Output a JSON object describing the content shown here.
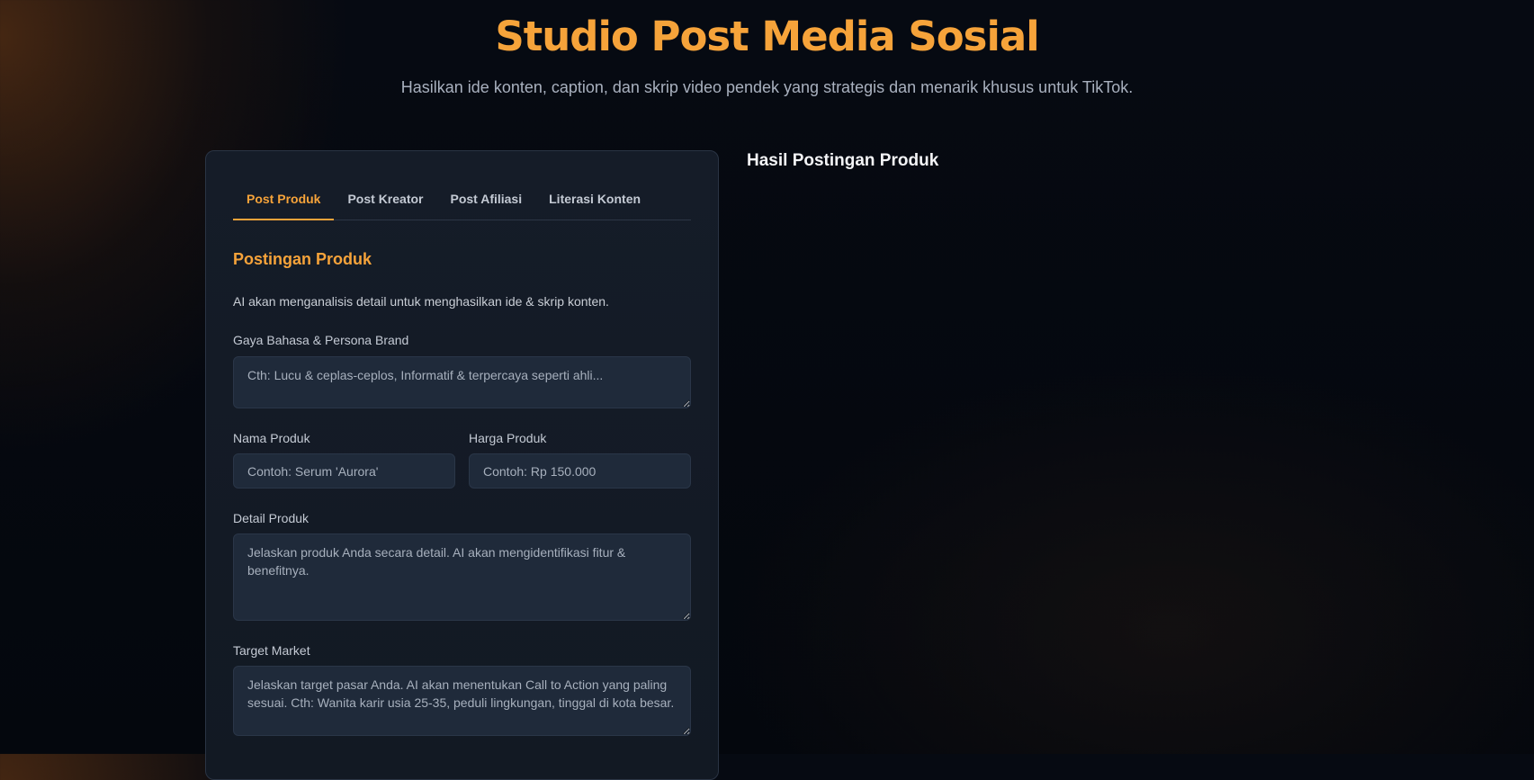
{
  "header": {
    "title": "Studio Post Media Sosial",
    "subtitle": "Hasilkan ide konten, caption, dan skrip video pendek yang strategis dan menarik khusus untuk TikTok."
  },
  "tabs": [
    {
      "label": "Post Produk",
      "active": true
    },
    {
      "label": "Post Kreator",
      "active": false
    },
    {
      "label": "Post Afiliasi",
      "active": false
    },
    {
      "label": "Literasi Konten",
      "active": false
    }
  ],
  "form": {
    "section_title": "Postingan Produk",
    "description": "AI akan menganalisis detail untuk menghasilkan ide & skrip konten.",
    "persona": {
      "label": "Gaya Bahasa & Persona Brand",
      "placeholder": "Cth: Lucu & ceplas-ceplos, Informatif & terpercaya seperti ahli...",
      "value": ""
    },
    "product_name": {
      "label": "Nama Produk",
      "placeholder": "Contoh: Serum 'Aurora'",
      "value": ""
    },
    "product_price": {
      "label": "Harga Produk",
      "placeholder": "Contoh: Rp 150.000",
      "value": ""
    },
    "product_detail": {
      "label": "Detail Produk",
      "placeholder": "Jelaskan produk Anda secara detail. AI akan mengidentifikasi fitur & benefitnya.",
      "value": ""
    },
    "target_market": {
      "label": "Target Market",
      "placeholder": "Jelaskan target pasar Anda. AI akan menentukan Call to Action yang paling sesuai. Cth: Wanita karir usia 25-35, peduli lingkungan, tinggal di kota besar.",
      "value": ""
    }
  },
  "results": {
    "title": "Hasil Postingan Produk"
  },
  "colors": {
    "accent": "#f6a33a",
    "card_bg": "#151c28",
    "field_bg": "#1f2a3a"
  }
}
